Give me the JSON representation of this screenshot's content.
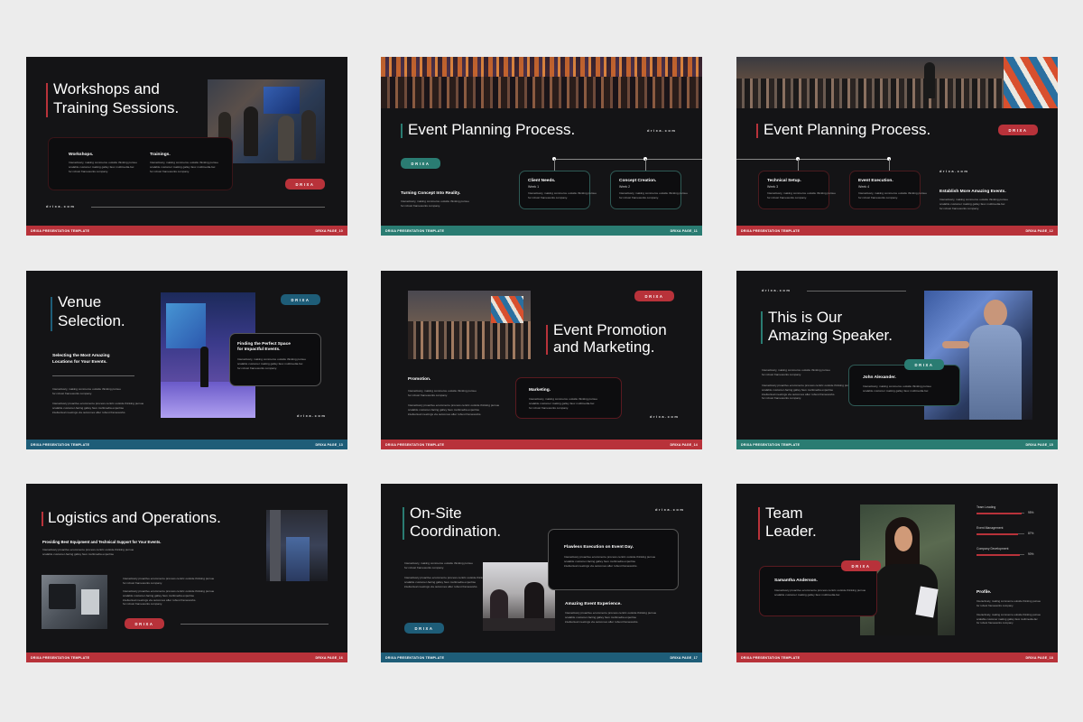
{
  "colors": {
    "red": "#b8323a",
    "teal": "#2a7c72",
    "blue": "#1e5d78",
    "dark": "#141416",
    "background": "#ececec"
  },
  "footer": {
    "left": "DRIXA PRESENTATION TEMPLATE",
    "pages": [
      "DRIXA PAGE_10",
      "DRIXA PAGE_11",
      "DRIXA PAGE_12",
      "DRIXA PAGE_13",
      "DRIXA PAGE_14",
      "DRIXA PAGE_15",
      "DRIXA PAGE_16",
      "DRIXA PAGE_17",
      "DRIXA PAGE_18"
    ]
  },
  "brand_button": "DRIXA",
  "website": "drixa.com",
  "lorem_short": "Interactively, making commerce outside thinking pursue",
  "lorem_short2": "scalable customer making galley faux multimedia-fac",
  "lorem_short3": "for robust frameworks company.",
  "lorem_long": "Interactively proactive ecommerce process centric outside thinking pursue",
  "lorem_long2": "scalable customer-facing galley faux multimedia expertise",
  "lorem_long3": "intellectual meetings via outcomes after robust frameworks.",
  "slide1": {
    "title1": "Workshops and",
    "title2": "Training Sessions.",
    "h1": "Workshops.",
    "h2": "Trainings."
  },
  "slide2": {
    "title": "Event Planning Process.",
    "intro": "Turning Concept Into Reality.",
    "steps": [
      {
        "title": "Client Needs.",
        "week": "Week 1"
      },
      {
        "title": "Concept Creation.",
        "week": "Week 2"
      }
    ]
  },
  "slide3": {
    "title": "Event Planning Process.",
    "intro": "Establish More Amazing Events.",
    "steps": [
      {
        "title": "Technical Setup.",
        "week": "Week 3"
      },
      {
        "title": "Event Execution.",
        "week": "Week 4"
      }
    ]
  },
  "slide4": {
    "title1": "Venue",
    "title2": "Selection.",
    "sub1": "Selecting the Most Amazing",
    "sub2": "Locations for Your Events.",
    "box1": "Finding the Perfect Space",
    "box2": "for Impactful Events."
  },
  "slide5": {
    "title1": "Event Promotion",
    "title2": "and Marketing.",
    "h1": "Promotion.",
    "h2": "Marketing."
  },
  "slide6": {
    "title1": "This is Our",
    "title2": "Amazing Speaker.",
    "name": "John Alexander."
  },
  "slide7": {
    "title": "Logistics and Operations.",
    "sub": "Providing Best Equipment and Technical Support for Your Events."
  },
  "slide8": {
    "title1": "On-Site",
    "title2": "Coordination.",
    "h1": "Flawless Execution on Event Day.",
    "h2": "Amazing Event Experience."
  },
  "slide9": {
    "title1": "Team",
    "title2": "Leader.",
    "name": "Samantha Anderson.",
    "profile": "Profile.",
    "skills": [
      {
        "label": "Team Leading",
        "value": "95%",
        "fraction": 0.95
      },
      {
        "label": "Event Management",
        "value": "87%",
        "fraction": 0.87
      },
      {
        "label": "Company Development",
        "value": "90%",
        "fraction": 0.9
      }
    ]
  }
}
